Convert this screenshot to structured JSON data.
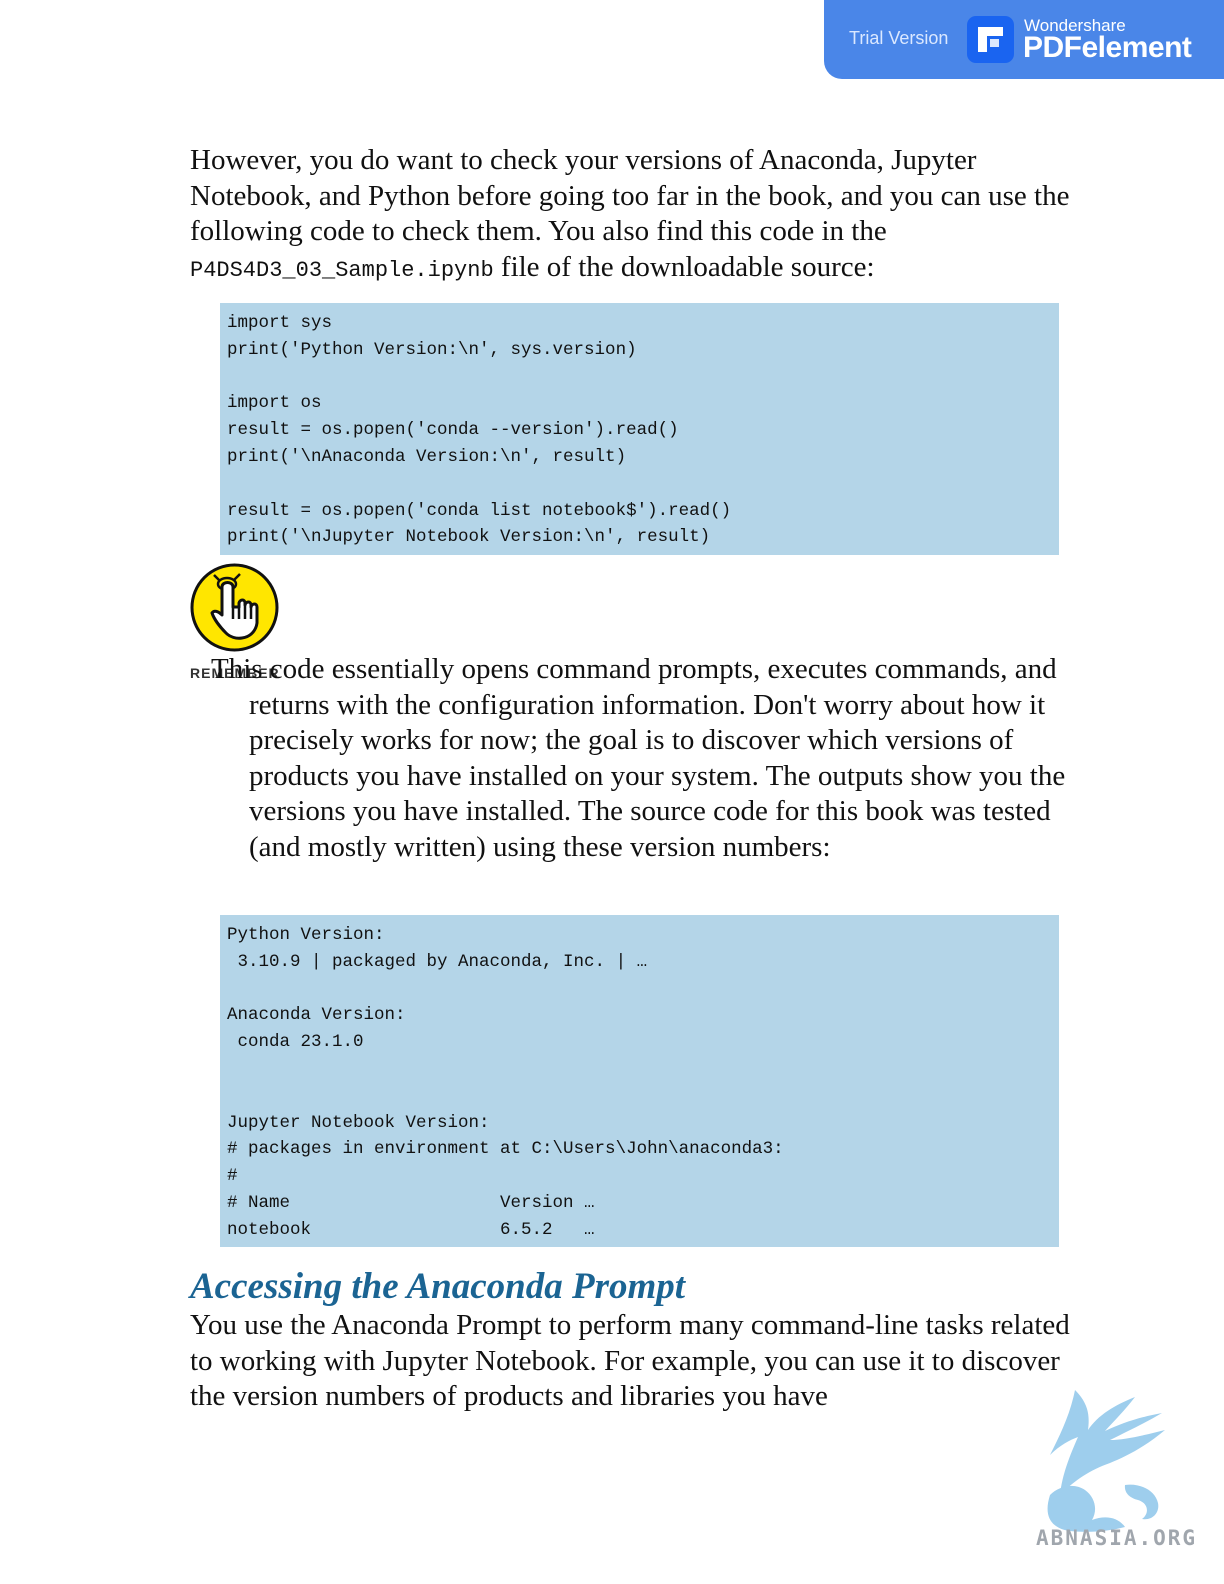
{
  "banner": {
    "trial_label": "Trial Version",
    "brand": "Wondershare",
    "product": "PDFelement"
  },
  "intro_paragraph": {
    "text_before": "However, you do want to check your versions of Anaconda, Jupyter Notebook, and Python before going too far in the book, and you can use the following code to check them. You also find this code in the ",
    "filename": "P4DS4D3_03_Sample.ipynb",
    "text_after": " file of the downloadable source:"
  },
  "code_block_1": "import sys\nprint('Python Version:\\n', sys.version)\n\nimport os\nresult = os.popen('conda --version').read()\nprint('\\nAnaconda Version:\\n', result)\n\nresult = os.popen('conda list notebook$').read()\nprint('\\nJupyter Notebook Version:\\n', result)",
  "remember": {
    "label": "REMEMBER",
    "icon": "pointing-finger-string-icon",
    "text": "This code essentially opens command prompts, executes commands, and returns with the configuration information. Don't worry about how it precisely works for now; the goal is to discover which versions of products you have installed on your system. The outputs show you the versions you have installed. The source code for this book was tested (and mostly written) using these version numbers:"
  },
  "code_block_2": "Python Version:\n 3.10.9 | packaged by Anaconda, Inc. | …\n\nAnaconda Version:\n conda 23.1.0\n\n\nJupyter Notebook Version:\n# packages in environment at C:\\Users\\John\\anaconda3:\n#\n# Name                    Version …\nnotebook                  6.5.2   …",
  "section": {
    "heading": "Accessing the Anaconda Prompt",
    "paragraph": "You use the Anaconda Prompt to perform many command-line tasks related to working with Jupyter Notebook. For example, you can use it to discover the version numbers of products and libraries you have"
  },
  "watermark": {
    "text": "ABNASIA.ORG",
    "icon": "griffin-logo-icon"
  },
  "colors": {
    "banner_bg": "#4a86e8",
    "code_bg": "#b4d5e8",
    "heading": "#1b6493",
    "remember_yellow": "#ffe600"
  }
}
